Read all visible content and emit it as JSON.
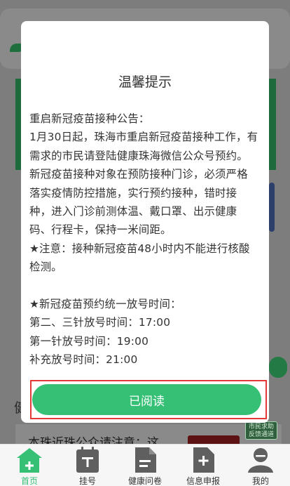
{
  "background": {
    "section_heading": "健",
    "news_item": "本珠近珠公众请注意：这",
    "feedback_badge": "市民求助反馈通道"
  },
  "modal": {
    "title": "温馨提示",
    "lines": [
      "重启新冠疫苗接种公告：",
      "1月30日起，珠海市重启新冠疫苗接种工作，有",
      "需求的市民请登陆健康珠海微信公众号预约。",
      "新冠疫苗接种对象在预防接种门诊，必须严格",
      "落实疫情防控措施，实行预约接种，错时接",
      "种，进入门诊前测体温、戴口罩、出示健康",
      "码、行程卡，保持一米间距。",
      "★注意：接种新冠疫苗48小时内不能进行核酸",
      "检测。",
      "",
      "★新冠疫苗预约统一放号时间：",
      "第二、三针放号时间：17:00",
      "第一针放号时间：19:00",
      "补充放号时间：21:00"
    ],
    "confirm_button": "已阅读"
  },
  "tabbar": {
    "items": [
      {
        "label": "首页",
        "icon": "home-plus-icon",
        "active": true
      },
      {
        "label": "挂号",
        "icon": "calendar-icon",
        "active": false
      },
      {
        "label": "健康问卷",
        "icon": "document-icon",
        "active": false
      },
      {
        "label": "信息申报",
        "icon": "report-plus-icon",
        "active": false
      },
      {
        "label": "我的",
        "icon": "user-icon",
        "active": false
      }
    ]
  },
  "colors": {
    "accent": "#35c075",
    "highlight_outline": "#e23a3a",
    "icon_gray": "#5f5f5f"
  }
}
